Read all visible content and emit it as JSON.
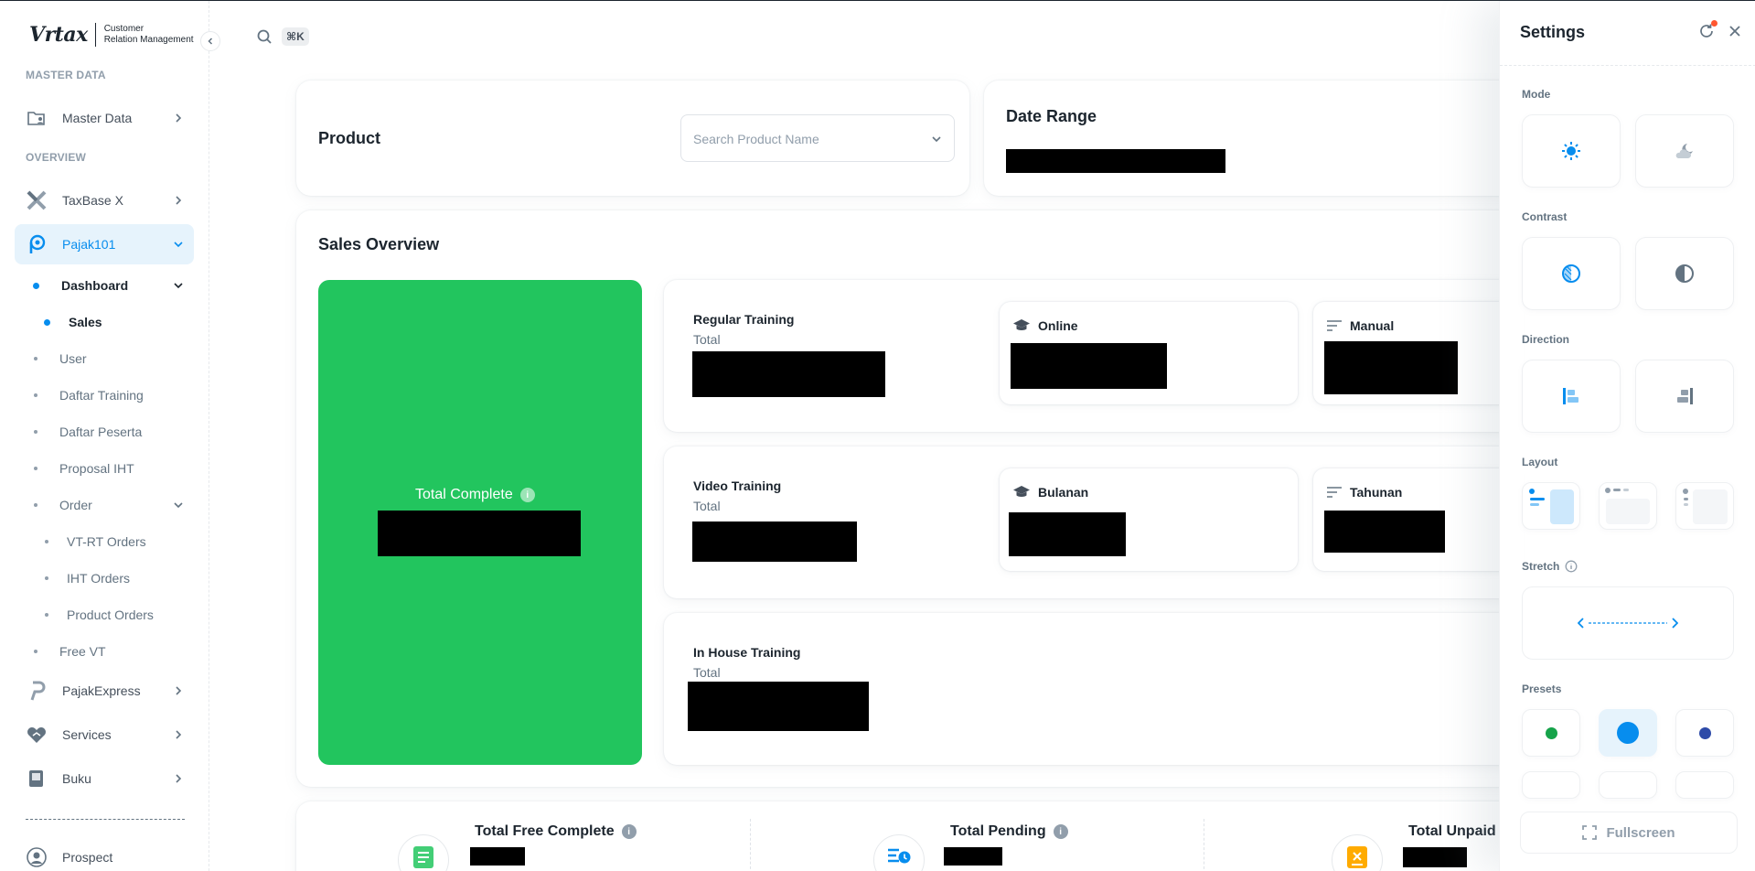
{
  "brand": {
    "logo_text": "Vrtax",
    "subtitle_line1": "Customer",
    "subtitle_line2": "Relation Management"
  },
  "search": {
    "shortcut": "⌘K"
  },
  "sidebar": {
    "section_master": "MASTER DATA",
    "section_overview": "OVERVIEW",
    "master_data": "Master Data",
    "taxbase": "TaxBase X",
    "pajak101": "Pajak101",
    "dashboard": "Dashboard",
    "sales": "Sales",
    "user": "User",
    "daftar_training": "Daftar Training",
    "daftar_peserta": "Daftar Peserta",
    "proposal_iht": "Proposal IHT",
    "order": "Order",
    "vt_rt_orders": "VT-RT Orders",
    "iht_orders": "IHT Orders",
    "product_orders": "Product Orders",
    "free_vt": "Free VT",
    "pajakexpress": "PajakExpress",
    "services": "Services",
    "buku": "Buku",
    "prospect": "Prospect"
  },
  "filters": {
    "product_title": "Product",
    "product_placeholder": "Search Product Name",
    "date_range_title": "Date Range"
  },
  "sales_overview": {
    "title": "Sales Overview",
    "total_complete": "Total Complete",
    "info": "i",
    "regular": {
      "title": "Regular Training",
      "sub": "Total",
      "online": "Online",
      "manual": "Manual"
    },
    "video": {
      "title": "Video Training",
      "sub": "Total",
      "bulanan": "Bulanan",
      "tahunan": "Tahunan"
    },
    "inhouse": {
      "title": "In House Training",
      "sub": "Total"
    }
  },
  "stats": {
    "free_complete": "Total Free Complete",
    "pending": "Total Pending",
    "unpaid": "Total Unpaid"
  },
  "settings": {
    "title": "Settings",
    "mode": "Mode",
    "contrast": "Contrast",
    "direction": "Direction",
    "layout": "Layout",
    "stretch": "Stretch",
    "presets": "Presets",
    "fullscreen": "Fullscreen",
    "preset_colors": [
      "#16a34a",
      "#078dee",
      "#2d4aa8"
    ]
  },
  "colors": {
    "primary": "#078dee",
    "success": "#22c55e"
  }
}
